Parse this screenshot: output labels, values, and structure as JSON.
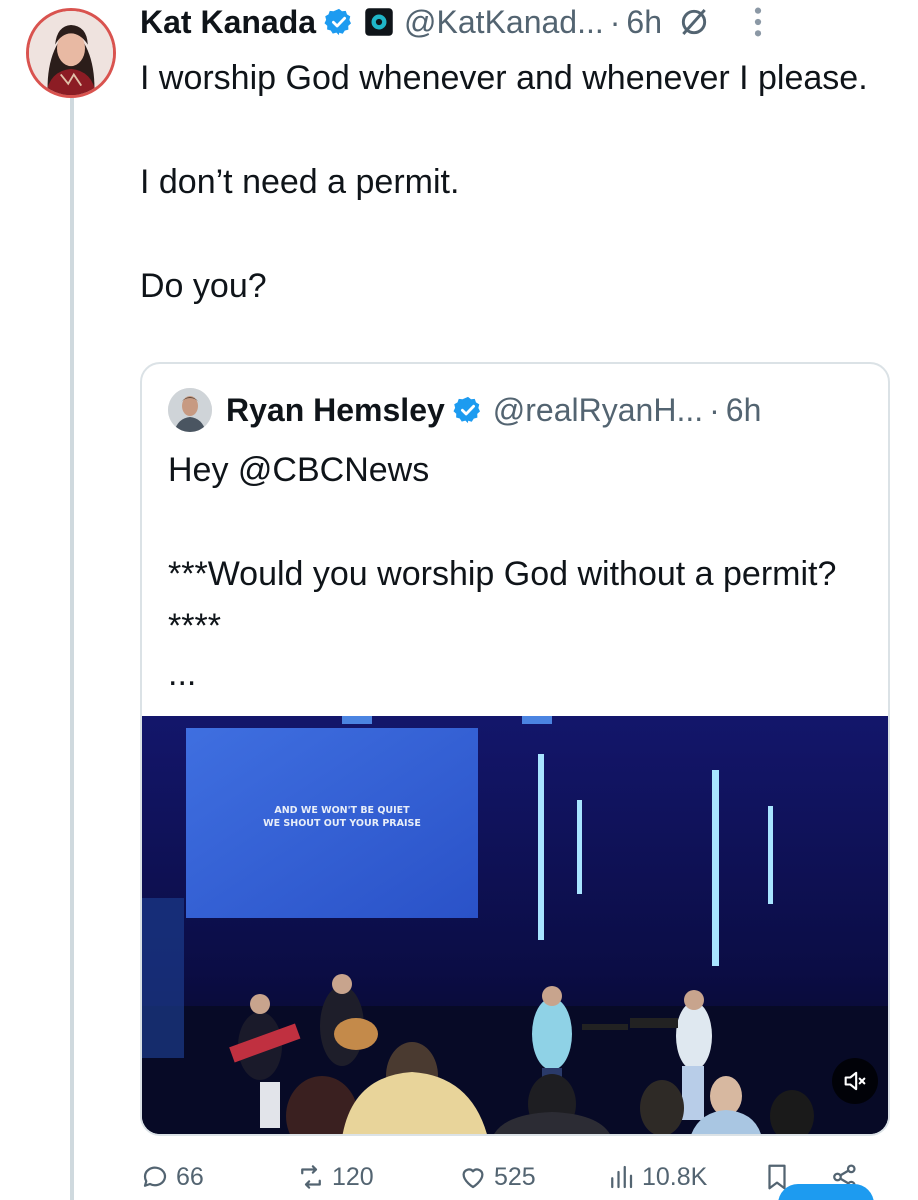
{
  "tweet": {
    "author_name": "Kat Kanada",
    "handle": "@KatKanad...",
    "separator": "·",
    "time": "6h",
    "paragraphs": [
      "I worship God whenever and whenever I please.",
      "I don’t need a permit.",
      "Do you?"
    ]
  },
  "quoted": {
    "author_name": "Ryan Hemsley",
    "handle": "@realRyanH...",
    "separator": "·",
    "time": "6h",
    "paragraphs": [
      "Hey @CBCNews",
      "***Would you worship God without a permit?****",
      "..."
    ],
    "video": {
      "screen_lyrics_line1": "AND WE WON'T BE QUIET",
      "screen_lyrics_line2": "WE SHOUT OUT YOUR PRAISE"
    }
  },
  "actions": {
    "replies": "66",
    "reposts": "120",
    "likes": "525",
    "views": "10.8K"
  },
  "colors": {
    "verified": "#1d9bf0",
    "muted_text": "#536471",
    "thread_line": "#cfd9de"
  },
  "icons": [
    "verified-badge-icon",
    "affiliate-badge-icon",
    "grok-icon",
    "more-icon",
    "mute-icon",
    "reply-icon",
    "repost-icon",
    "like-icon",
    "views-icon",
    "bookmark-icon",
    "share-icon"
  ]
}
